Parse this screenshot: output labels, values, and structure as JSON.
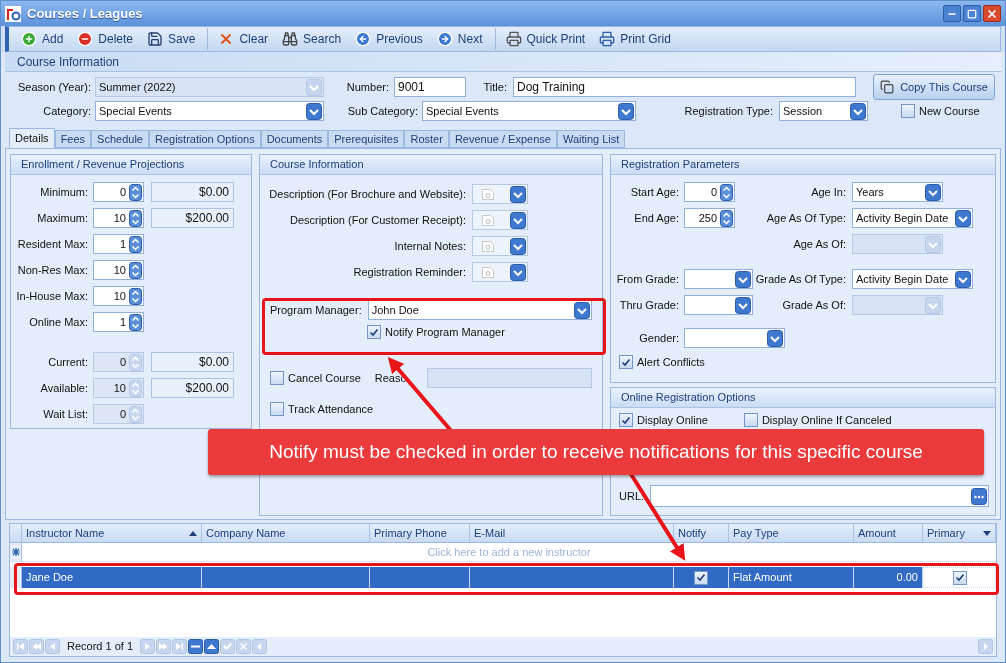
{
  "window": {
    "title": "Courses / Leagues"
  },
  "toolbar": [
    [
      {
        "label": "Add"
      },
      {
        "label": "Delete"
      },
      {
        "label": "Save"
      }
    ],
    [
      {
        "label": "Clear"
      },
      {
        "label": "Search"
      },
      {
        "label": "Previous"
      },
      {
        "label": "Next"
      }
    ],
    [
      {
        "label": "Quick Print"
      },
      {
        "label": "Print Grid"
      }
    ]
  ],
  "course_information": {
    "title": "Course Information",
    "season": {
      "label": "Season (Year):",
      "value": "Summer (2022)",
      "disabled": true
    },
    "number": {
      "label": "Number:",
      "value": "9001"
    },
    "course_title": {
      "label": "Title:",
      "value": "Dog Training"
    },
    "copy_button": "Copy This Course",
    "category": {
      "label": "Category:",
      "value": "Special Events",
      "disabled": false
    },
    "sub_category": {
      "label": "Sub Category:",
      "value": "Special Events",
      "disabled": false
    },
    "registration_type": {
      "label": "Registration Type:",
      "value": "Session",
      "disabled": false
    },
    "new_course": {
      "label": "New Course",
      "checked": false
    }
  },
  "tabs": [
    {
      "label": "Details",
      "selected": true
    },
    {
      "label": "Fees",
      "selected": false
    },
    {
      "label": "Schedule",
      "selected": false
    },
    {
      "label": "Registration Options",
      "selected": false
    },
    {
      "label": "Documents",
      "selected": false
    },
    {
      "label": "Prerequisites",
      "selected": false
    },
    {
      "label": "Roster",
      "selected": false
    },
    {
      "label": "Revenue / Expense",
      "selected": false
    },
    {
      "label": "Waiting List",
      "selected": false
    }
  ],
  "enrollment": {
    "title": "Enrollment / Revenue Projections",
    "limits": [
      {
        "label": "Minimum:",
        "value": "0",
        "amount": "$0.00",
        "disabled": false
      },
      {
        "label": "Maximum:",
        "value": "10",
        "amount": "$200.00",
        "disabled": false
      },
      {
        "label": "Resident Max:",
        "value": "1",
        "disabled": false
      },
      {
        "label": "Non-Res Max:",
        "value": "10",
        "disabled": false
      },
      {
        "label": "In-House Max:",
        "value": "10",
        "disabled": false
      },
      {
        "label": "Online Max:",
        "value": "1",
        "disabled": false
      }
    ],
    "status": [
      {
        "label": "Current:",
        "value": "0",
        "amount": "$0.00",
        "disabled": true
      },
      {
        "label": "Available:",
        "value": "10",
        "amount": "$200.00",
        "disabled": true
      },
      {
        "label": "Wait List:",
        "value": "0",
        "disabled": true
      }
    ]
  },
  "course_panel": {
    "title": "Course Information",
    "notes": [
      {
        "label": "Description (For Brochure and Website):"
      },
      {
        "label": "Description (For Customer Receipt):"
      },
      {
        "label": "Internal Notes:"
      },
      {
        "label": "Registration Reminder:"
      }
    ],
    "program_manager": {
      "label": "Program Manager:",
      "value": "John Doe"
    },
    "notify": {
      "label": "Notify Program Manager",
      "checked": true
    },
    "cancel": {
      "label": "Cancel Course",
      "checked": false
    },
    "reason": {
      "label": "Reaso",
      "disabled": true
    },
    "track": {
      "label": "Track Attendance",
      "checked": false
    }
  },
  "registration_parameters": {
    "title": "Registration Parameters",
    "start_age": {
      "label": "Start Age:",
      "value": "0"
    },
    "end_age": {
      "label": "End Age:",
      "value": "250"
    },
    "age_in": {
      "label": "Age In:",
      "value": "Years",
      "disabled": false
    },
    "age_as_of_type": {
      "label": "Age As Of Type:",
      "value": "Activity Begin Date",
      "disabled": false
    },
    "age_as_of": {
      "label": "Age As Of:",
      "disabled": true
    },
    "from_grade": {
      "label": "From Grade:",
      "disabled": false
    },
    "grade_as_of_type": {
      "label": "Grade As Of Type:",
      "value": "Activity Begin Date",
      "disabled": false
    },
    "thru_grade": {
      "label": "Thru Grade:",
      "disabled": false
    },
    "grade_as_of": {
      "label": "Grade As Of:",
      "disabled": true
    },
    "gender": {
      "label": "Gender:",
      "disabled": false
    },
    "alert_conflicts": {
      "label": "Alert Conflicts",
      "checked": true
    }
  },
  "online_options": {
    "title": "Online Registration Options",
    "display_online": {
      "label": "Display Online",
      "checked": true
    },
    "display_online_if_canceled": {
      "label": "Display Online If Canceled",
      "checked": false
    },
    "url": {
      "label": "URL:"
    }
  },
  "grid": {
    "columns": [
      {
        "label": "Instructor Name",
        "sorted": true
      },
      {
        "label": "Company Name"
      },
      {
        "label": "Primary Phone"
      },
      {
        "label": "E-Mail"
      },
      {
        "label": "Notify"
      },
      {
        "label": "Pay Type"
      },
      {
        "label": "Amount"
      },
      {
        "label": "Primary",
        "menu": true
      }
    ],
    "new_row_hint": "Click here to add a new instructor",
    "rows": [
      {
        "selected": true,
        "instructor_name": "Jane Doe",
        "notify": true,
        "pay_type": "Flat Amount",
        "amount": "0.00",
        "primary": true
      }
    ]
  },
  "navigator": {
    "record": "Record 1 of 1"
  },
  "callout": {
    "text": "Notify must be checked in order to receive notifications for this specific course"
  }
}
